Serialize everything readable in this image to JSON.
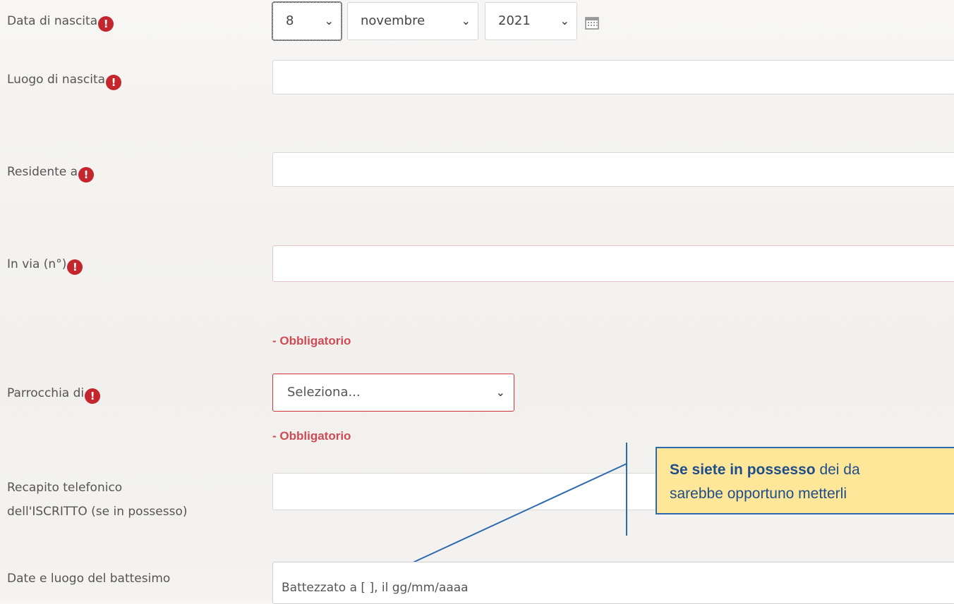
{
  "fields": {
    "data_nascita": {
      "label": "Data di nascita"
    },
    "luogo_nascita": {
      "label": "Luogo di nascita",
      "value": ""
    },
    "residente": {
      "label": "Residente a",
      "value": ""
    },
    "via": {
      "label": "In via (n°)",
      "value": "",
      "error": "- Obbligatorio"
    },
    "parrocchia": {
      "label": "Parrocchia di",
      "selected": "Seleziona...",
      "error": "- Obbligatorio"
    },
    "telefono": {
      "label_line1": "Recapito telefonico",
      "label_line2": "dell'ISCRITTO (se in possesso)",
      "value": ""
    },
    "battesimo": {
      "label": "Date e luogo del battesimo",
      "value": "Battezzato a  [ ], il  gg/mm/aaaa"
    }
  },
  "birth_date": {
    "day": "8",
    "month": "novembre",
    "year": "2021"
  },
  "required_icon": "!",
  "chevron": "❯",
  "callout": {
    "bold": "Se siete in possesso",
    "rest_line1": " dei da",
    "line2": "sarebbe opportuno metterli"
  },
  "colors": {
    "required": "#c4262e",
    "error_text": "#d04a55",
    "callout_bg": "#ffe79a",
    "callout_border": "#2b69b0"
  }
}
